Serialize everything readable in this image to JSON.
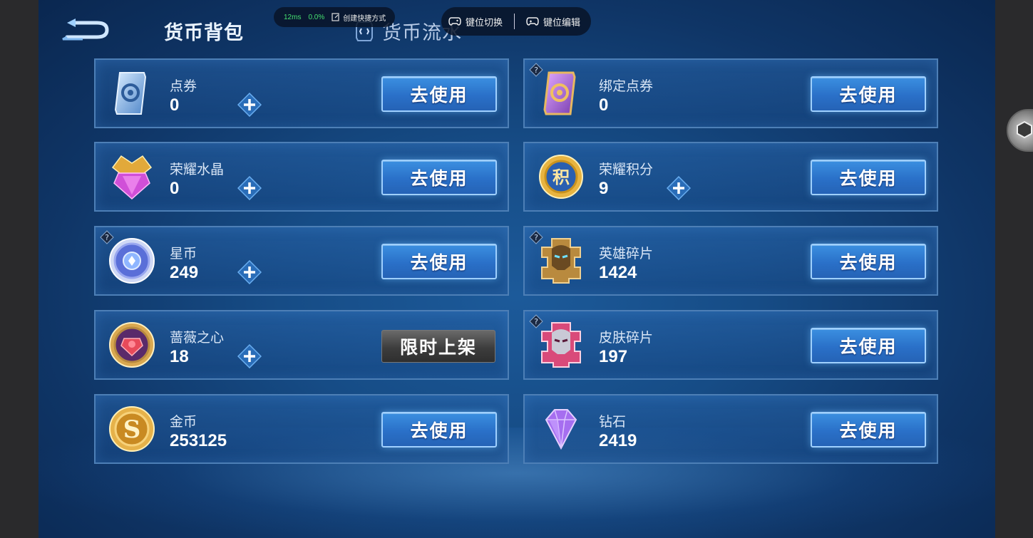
{
  "header": {
    "tab_bag": "货币背包",
    "tab_flow": "货币流水"
  },
  "overlay": {
    "latency": "12ms",
    "cpu": "0.0%",
    "shortcut": "创建快捷方式",
    "key_switch": "键位切换",
    "key_edit": "键位编辑"
  },
  "buttons": {
    "use": "去使用",
    "limited": "限时上架"
  },
  "currencies": [
    {
      "name": "点券",
      "amount": "0",
      "icon": "voucher-card-icon",
      "has_plus": true,
      "has_help": false,
      "action": "use"
    },
    {
      "name": "绑定点券",
      "amount": "0",
      "icon": "bound-voucher-card-icon",
      "has_plus": false,
      "has_help": true,
      "action": "use"
    },
    {
      "name": "荣耀水晶",
      "amount": "0",
      "icon": "glory-crystal-icon",
      "has_plus": true,
      "has_help": false,
      "action": "use"
    },
    {
      "name": "荣耀积分",
      "amount": "9",
      "icon": "glory-points-icon",
      "has_plus": true,
      "has_help": false,
      "action": "use"
    },
    {
      "name": "星币",
      "amount": "249",
      "icon": "star-coin-icon",
      "has_plus": true,
      "has_help": true,
      "action": "use"
    },
    {
      "name": "英雄碎片",
      "amount": "1424",
      "icon": "hero-fragment-icon",
      "has_plus": false,
      "has_help": true,
      "action": "use"
    },
    {
      "name": "蔷薇之心",
      "amount": "18",
      "icon": "rose-heart-icon",
      "has_plus": true,
      "has_help": false,
      "action": "limited"
    },
    {
      "name": "皮肤碎片",
      "amount": "197",
      "icon": "skin-fragment-icon",
      "has_plus": false,
      "has_help": true,
      "action": "use"
    },
    {
      "name": "金币",
      "amount": "253125",
      "icon": "gold-coin-icon",
      "has_plus": false,
      "has_help": false,
      "action": "use"
    },
    {
      "name": "钻石",
      "amount": "2419",
      "icon": "diamond-icon",
      "has_plus": false,
      "has_help": false,
      "action": "use"
    }
  ],
  "colors": {
    "accent_blue": "#2f7fd8",
    "panel_border": "#4d7fb6",
    "bg_dark": "#0f3566"
  }
}
